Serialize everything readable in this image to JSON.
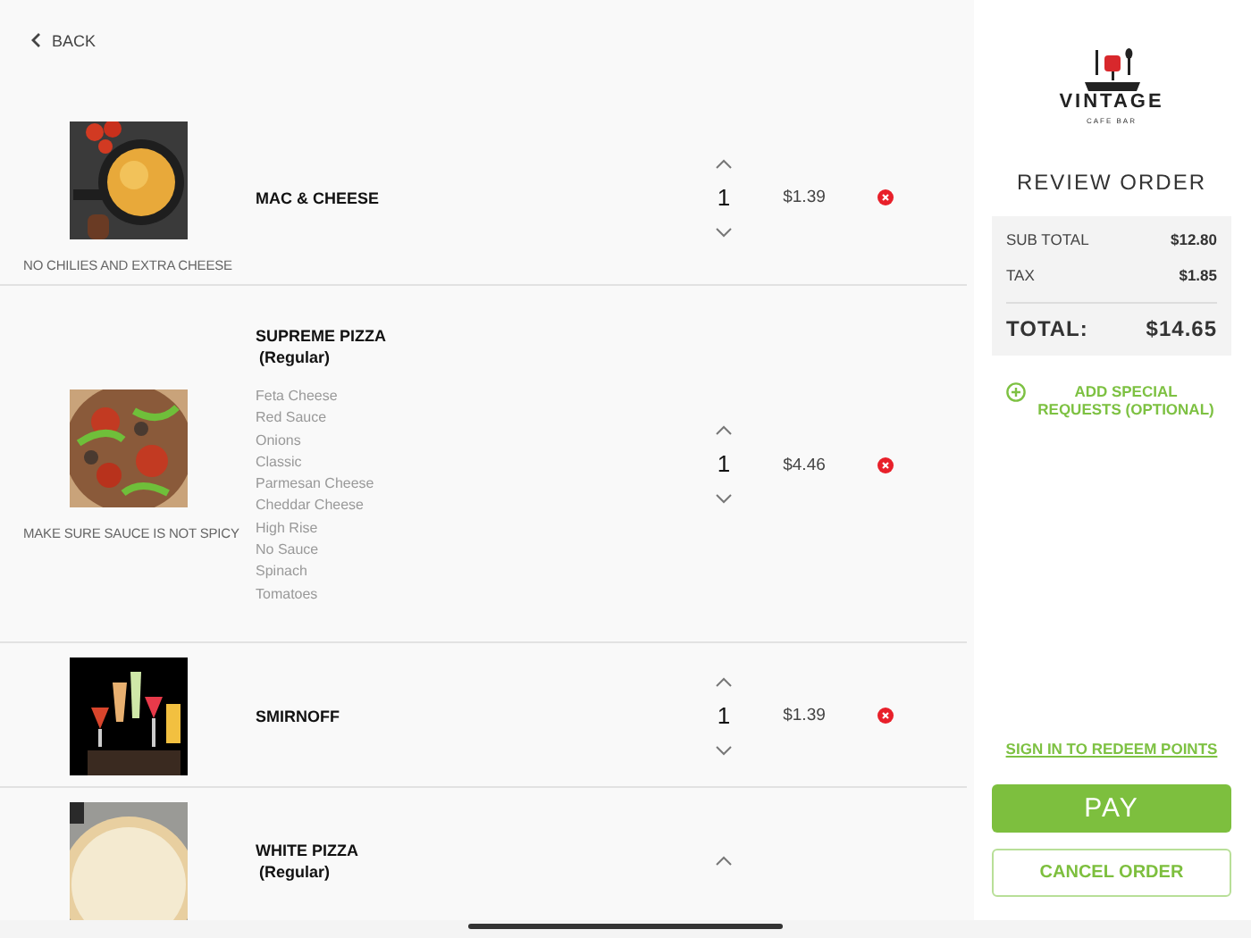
{
  "back": {
    "label": "BACK"
  },
  "items": [
    {
      "name": "MAC & CHEESE",
      "note": "NO CHILIES AND EXTRA CHEESE",
      "quantity": "1",
      "price": "$1.39"
    },
    {
      "name": "SUPREME PIZZA",
      "size": "(Regular)",
      "modifiers": [
        "Feta Cheese",
        "Red Sauce",
        "Onions",
        "Classic",
        "Parmesan Cheese",
        "Cheddar Cheese",
        "High Rise",
        "No Sauce",
        "Spinach",
        "Tomatoes"
      ],
      "note": "MAKE SURE SAUCE IS NOT SPICY",
      "quantity": "1",
      "price": "$4.46"
    },
    {
      "name": "SMIRNOFF",
      "quantity": "1",
      "price": "$1.39"
    },
    {
      "name": "WHITE PIZZA",
      "size": "(Regular)"
    }
  ],
  "logo": {
    "name": "VINTAGE",
    "tagline": "CAFE BAR"
  },
  "summary": {
    "title": "REVIEW ORDER",
    "lines": [
      {
        "label": "SUB TOTAL",
        "value": "$12.80"
      },
      {
        "label": "TAX",
        "value": "$1.85"
      }
    ],
    "total": {
      "label": "TOTAL:",
      "value": "$14.65"
    }
  },
  "special_requests": {
    "label": "ADD SPECIAL REQUESTS (OPTIONAL)"
  },
  "sign_in_link": "SIGN IN TO REDEEM POINTS",
  "buttons": {
    "pay": "PAY",
    "cancel": "CANCEL ORDER"
  }
}
